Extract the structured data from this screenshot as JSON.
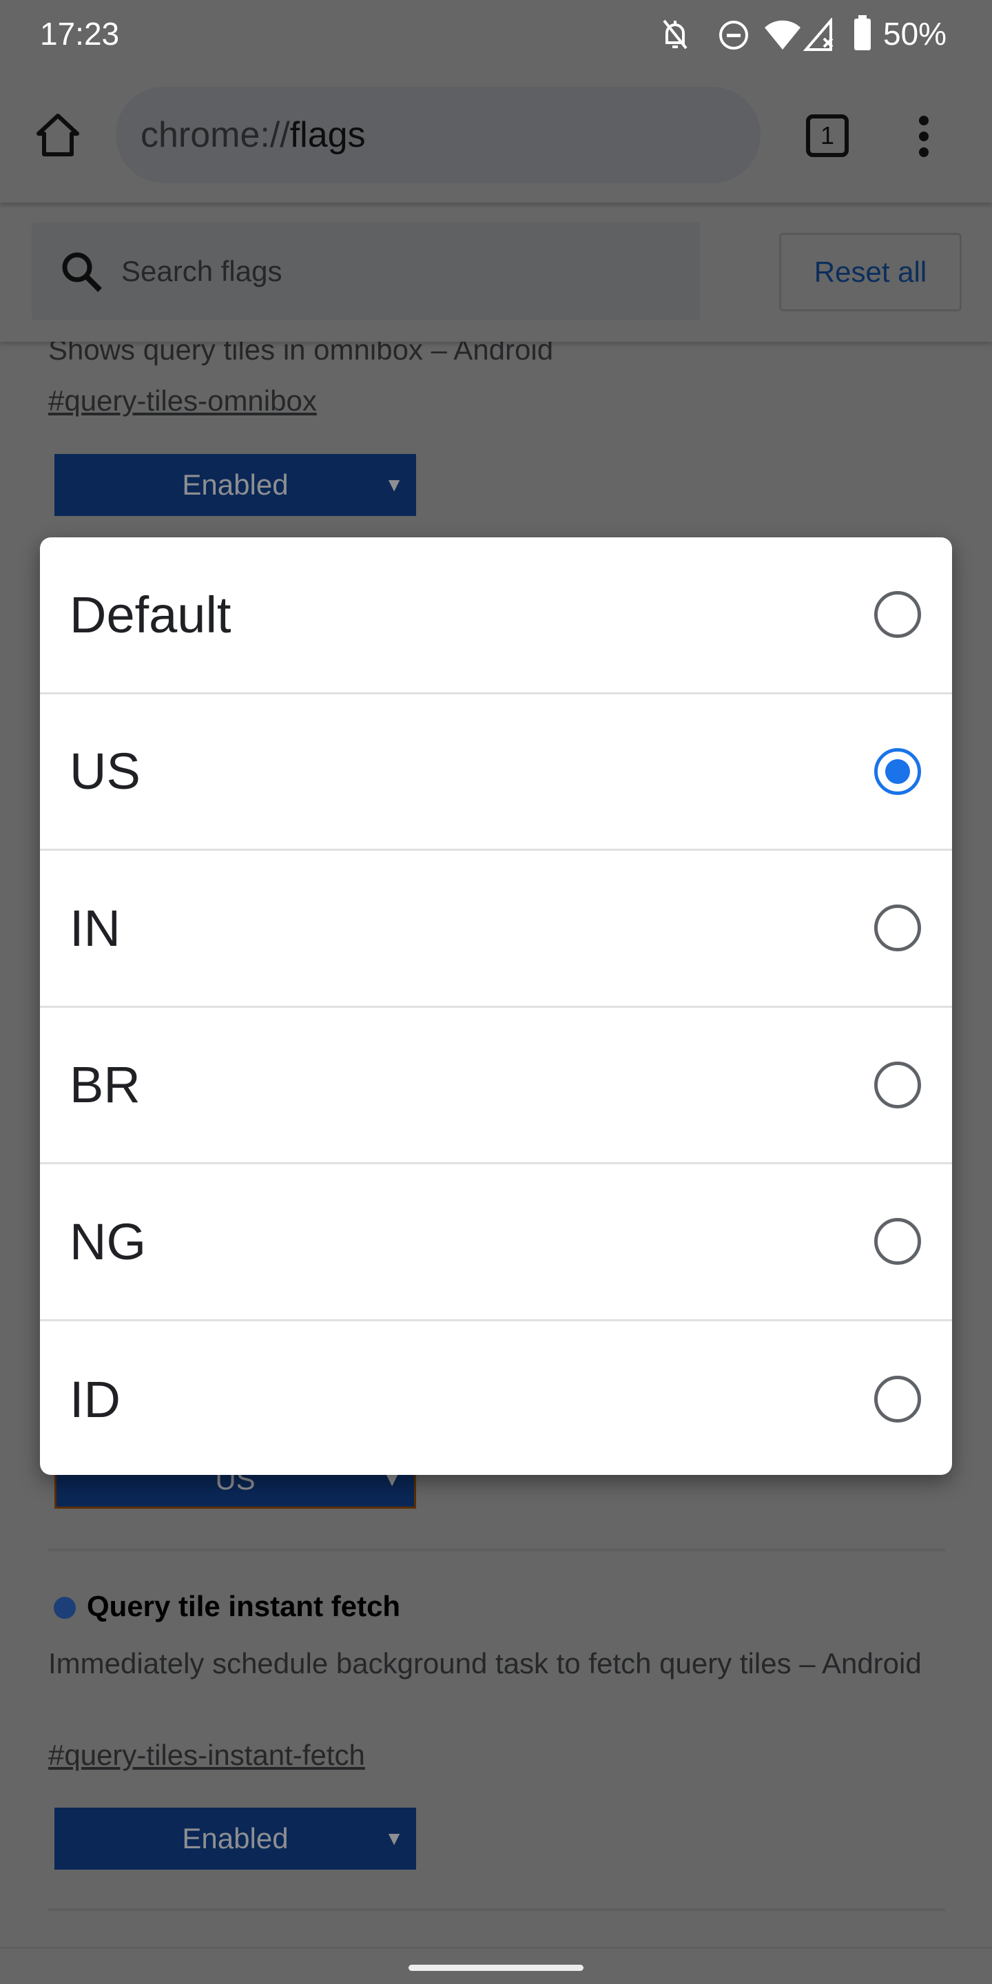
{
  "status_bar": {
    "time": "17:23",
    "battery": "50%",
    "icons": [
      "bell-off-icon",
      "do-not-disturb-icon",
      "wifi-icon",
      "signal-no-data-icon",
      "battery-icon"
    ]
  },
  "toolbar": {
    "url_scheme": "chrome://",
    "url_host": "flags",
    "tab_count": "1",
    "icons": [
      "home-icon",
      "tab-switcher-icon",
      "more-vert-icon"
    ]
  },
  "search": {
    "placeholder": "Search flags",
    "reset_label": "Reset all"
  },
  "flags": [
    {
      "description": "Shows query tiles in omnibox – Android",
      "link": "#query-tiles-omnibox",
      "value": "Enabled"
    },
    {
      "value": "US"
    },
    {
      "title": "Query tile instant fetch",
      "description": "Immediately schedule background task to fetch query tiles – Android",
      "link": "#query-tiles-instant-fetch",
      "value": "Enabled"
    }
  ],
  "dialog": {
    "options": [
      {
        "label": "Default",
        "selected": false
      },
      {
        "label": "US",
        "selected": true
      },
      {
        "label": "IN",
        "selected": false
      },
      {
        "label": "BR",
        "selected": false
      },
      {
        "label": "NG",
        "selected": false
      },
      {
        "label": "ID",
        "selected": false
      }
    ]
  },
  "colors": {
    "accent": "#1a73e8",
    "select_bg": "#1a62d8",
    "scrim": "rgba(0,0,0,0.6)"
  }
}
